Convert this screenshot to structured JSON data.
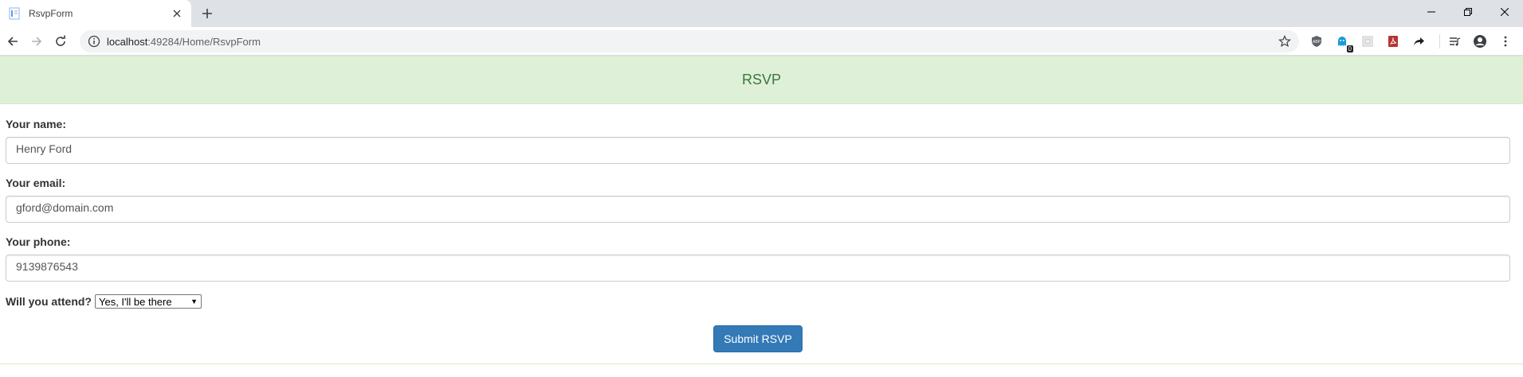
{
  "browser": {
    "tab_title": "RsvpForm",
    "url_host": "localhost",
    "url_rest": ":49284/Home/RsvpForm",
    "extension_badge": "0"
  },
  "page": {
    "heading": "RSVP",
    "name_label": "Your name:",
    "name_value": "Henry Ford",
    "email_label": "Your email:",
    "email_value": "gford@domain.com",
    "phone_label": "Your phone:",
    "phone_value": "9139876543",
    "attend_label": "Will you attend?",
    "attend_value": "Yes, I'll be there",
    "submit_label": "Submit RSVP"
  },
  "colors": {
    "heading_bg": "#dff0d8",
    "heading_text": "#3c763d",
    "button_bg": "#337ab7"
  }
}
